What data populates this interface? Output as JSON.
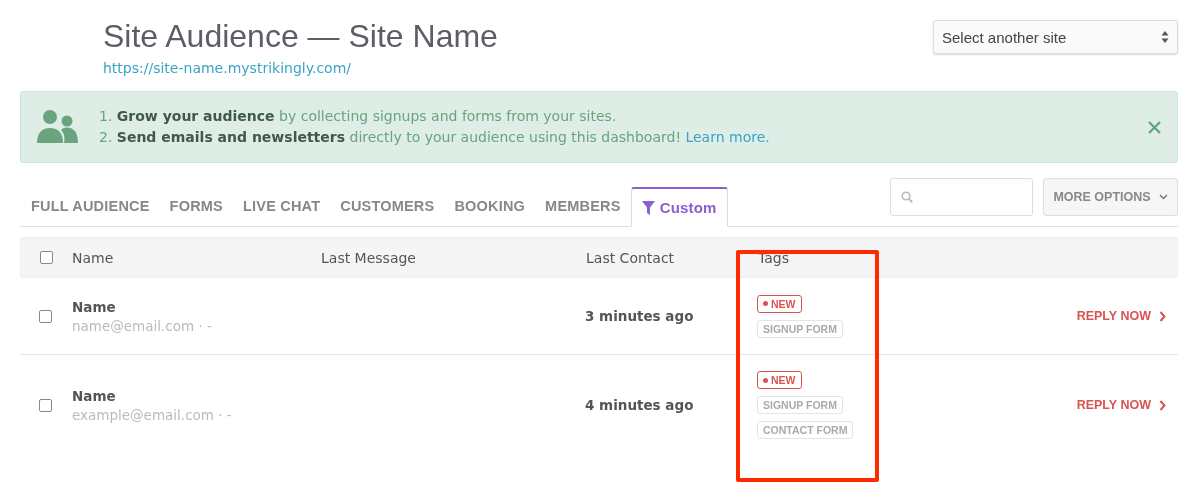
{
  "header": {
    "title": "Site Audience — Site Name",
    "url": "https://site-name.mystrikingly.com/",
    "site_select": "Select another site"
  },
  "banner": {
    "lines": [
      "1. **Grow your audience** by collecting signups and forms from your sites.",
      "2. **Send emails and newsletters** directly to your audience using this dashboard!"
    ],
    "link": "Learn more."
  },
  "tabs": [
    {
      "label": "FULL AUDIENCE",
      "selected": false
    },
    {
      "label": "FORMS",
      "selected": false
    },
    {
      "label": "LIVE CHAT",
      "selected": false
    },
    {
      "label": "CUSTOMERS",
      "selected": false
    },
    {
      "label": "BOOKING",
      "selected": false
    },
    {
      "label": "MEMBERS",
      "selected": false
    },
    {
      "label": "Custom",
      "selected": true,
      "kind": "filter"
    }
  ],
  "more_options": "MORE OPTIONS",
  "table": {
    "select_all_checked": false,
    "columns": [
      "Name",
      "Last Message",
      "Last Contact",
      "Tags"
    ],
    "rows": [
      {
        "checked": false,
        "name": "Name",
        "email": "name@email.com · -",
        "last_contact": "3 minutes ago",
        "tags": [
          {
            "label": "NEW",
            "kind": "new"
          },
          {
            "label": "SIGNUP FORM",
            "kind": "plain"
          }
        ],
        "action": "REPLY NOW"
      },
      {
        "checked": false,
        "name": "Name",
        "email": "example@email.com · -",
        "last_contact": "4 minutes ago",
        "tags": [
          {
            "label": "NEW",
            "kind": "new"
          },
          {
            "label": "SIGNUP FORM",
            "kind": "plain"
          },
          {
            "label": "CONTACT FORM",
            "kind": "plain"
          }
        ],
        "action": "REPLY NOW"
      }
    ]
  }
}
